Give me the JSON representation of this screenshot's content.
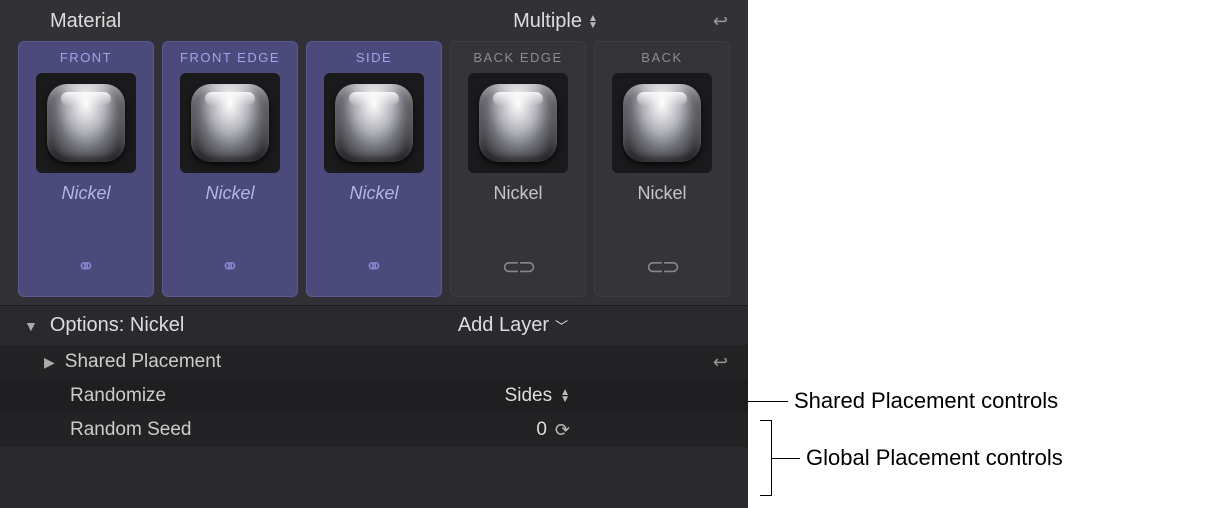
{
  "header": {
    "title": "Material",
    "dropdown_value": "Multiple"
  },
  "tiles": [
    {
      "face": "FRONT",
      "material": "Nickel",
      "selected": true,
      "linked": true
    },
    {
      "face": "FRONT EDGE",
      "material": "Nickel",
      "selected": true,
      "linked": true
    },
    {
      "face": "SIDE",
      "material": "Nickel",
      "selected": true,
      "linked": true
    },
    {
      "face": "BACK EDGE",
      "material": "Nickel",
      "selected": false,
      "linked": false
    },
    {
      "face": "BACK",
      "material": "Nickel",
      "selected": false,
      "linked": false
    }
  ],
  "options": {
    "title": "Options: Nickel",
    "add_layer_label": "Add Layer"
  },
  "params": {
    "shared_placement_label": "Shared Placement",
    "randomize_label": "Randomize",
    "randomize_value": "Sides",
    "random_seed_label": "Random Seed",
    "random_seed_value": "0"
  },
  "annotations": {
    "shared": "Shared Placement controls",
    "global": "Global Placement controls"
  }
}
